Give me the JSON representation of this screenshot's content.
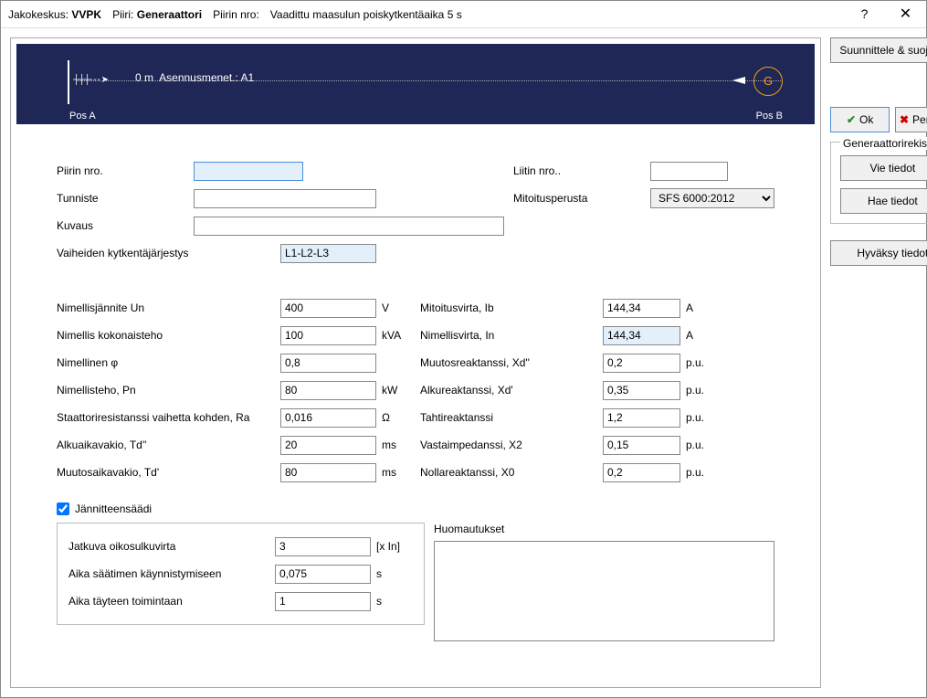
{
  "titlebar": {
    "jakokeskus_label": "Jakokeskus:",
    "jakokeskus_value": "VVPK",
    "piiri_label": "Piiri:",
    "piiri_value": "Generaattori",
    "piirin_nro_label": "Piirin nro:",
    "piirin_nro_value": "",
    "vaadittu_label": "Vaadittu maasulun poiskytkentäaika 5 s"
  },
  "diagram": {
    "distance": "0 m",
    "asennus": "Asennusmenet.: A1",
    "g_symbol": "G",
    "pos_a": "Pos A",
    "pos_b": "Pos B"
  },
  "fields": {
    "piirin_nro": {
      "label": "Piirin nro.",
      "value": ""
    },
    "tunniste": {
      "label": "Tunniste",
      "value": ""
    },
    "kuvaus": {
      "label": "Kuvaus",
      "value": ""
    },
    "vaiheet": {
      "label": "Vaiheiden kytkentäjärjestys",
      "value": "L1-L2-L3"
    },
    "liitin": {
      "label": "Liitin nro..",
      "value": ""
    },
    "mitoitusperusta": {
      "label": "Mitoitusperusta",
      "value": "SFS 6000:2012"
    },
    "un": {
      "label": "Nimellisjännite Un",
      "value": "400",
      "unit": "V"
    },
    "kokonaisteho": {
      "label": "Nimellis kokonaisteho",
      "value": "100",
      "unit": "kVA"
    },
    "phi": {
      "label": "Nimellinen φ",
      "value": "0,8",
      "unit": ""
    },
    "pn": {
      "label": "Nimellisteho, Pn",
      "value": "80",
      "unit": "kW"
    },
    "ra": {
      "label": "Staattoriresistanssi vaihetta kohden, Ra",
      "value": "0,016",
      "unit": "Ω"
    },
    "td2": {
      "label": "Alkuaikavakio, Td''",
      "value": "20",
      "unit": "ms"
    },
    "td1": {
      "label": "Muutosaikavakio, Td'",
      "value": "80",
      "unit": "ms"
    },
    "ib": {
      "label": "Mitoitusvirta, Ib",
      "value": "144,34",
      "unit": "A"
    },
    "in": {
      "label": "Nimellisvirta, In",
      "value": "144,34",
      "unit": "A"
    },
    "xd2": {
      "label": "Muutosreaktanssi, Xd''",
      "value": "0,2",
      "unit": "p.u."
    },
    "xd1": {
      "label": "Alkureaktanssi, Xd'",
      "value": "0,35",
      "unit": "p.u."
    },
    "tahti": {
      "label": "Tahtireaktanssi",
      "value": "1,2",
      "unit": "p.u."
    },
    "x2": {
      "label": "Vastaimpedanssi, X2",
      "value": "0,15",
      "unit": "p.u."
    },
    "x0": {
      "label": "Nollareaktanssi, X0",
      "value": "0,2",
      "unit": "p.u."
    },
    "jannitteensaadi": "Jännitteensäädi",
    "jatkuva": {
      "label": "Jatkuva oikosulkuvirta",
      "value": "3",
      "unit": "[x In]"
    },
    "aika_kaynn": {
      "label": "Aika säätimen käynnistymiseen",
      "value": "0,075",
      "unit": "s"
    },
    "aika_tayteen": {
      "label": "Aika täyteen toimintaan",
      "value": "1",
      "unit": "s"
    },
    "huomautukset": {
      "label": "Huomautukset",
      "value": ""
    }
  },
  "sidebar": {
    "suunnittele": "Suunnittele & suojaus",
    "ok": "Ok",
    "peruuta": "Peruuta",
    "gen_rekisteri": "Generaattorirekisteri",
    "vie": "Vie tiedot",
    "hae": "Hae tiedot",
    "hyvaksy": "Hyväksy tiedot"
  }
}
